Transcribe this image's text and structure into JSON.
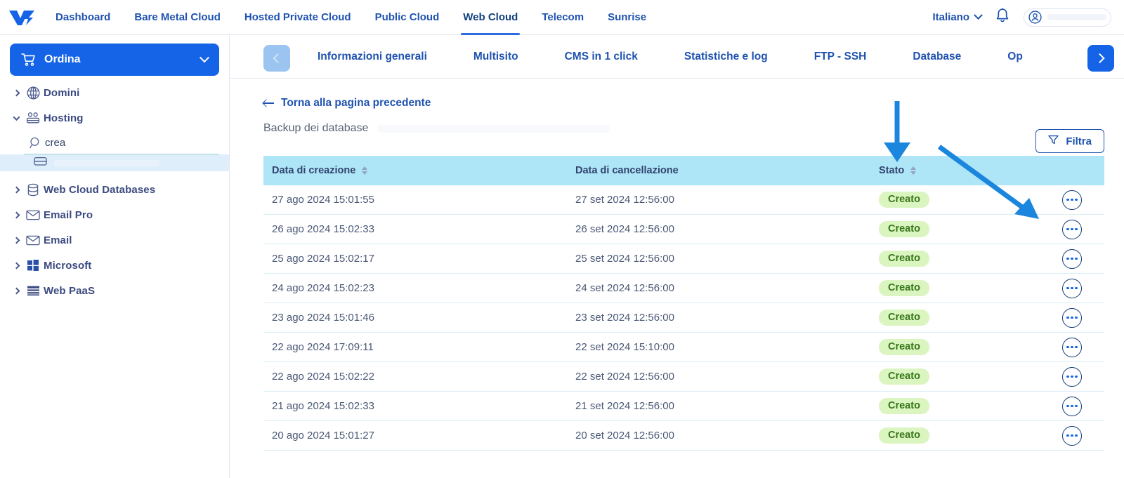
{
  "header": {
    "logo_name": "ovh-logo",
    "nav": [
      {
        "label": "Dashboard",
        "active": false
      },
      {
        "label": "Bare Metal Cloud",
        "active": false
      },
      {
        "label": "Hosted Private Cloud",
        "active": false
      },
      {
        "label": "Public Cloud",
        "active": false
      },
      {
        "label": "Web Cloud",
        "active": true
      },
      {
        "label": "Telecom",
        "active": false
      },
      {
        "label": "Sunrise",
        "active": false
      }
    ],
    "language": "Italiano",
    "bell_icon": "notification-bell-icon",
    "account_icon": "user-account-icon"
  },
  "sidebar": {
    "order_button": "Ordina",
    "order_icon": "shopping-cart-icon",
    "items": [
      {
        "label": "Domini",
        "icon": "globe-icon",
        "expanded": false
      },
      {
        "label": "Hosting",
        "icon": "hosting-icon",
        "expanded": true
      },
      {
        "label": "Web Cloud Databases",
        "icon": "database-icon",
        "expanded": false
      },
      {
        "label": "Email Pro",
        "icon": "envelope-icon",
        "expanded": false
      },
      {
        "label": "Email",
        "icon": "envelope-icon",
        "expanded": false
      },
      {
        "label": "Microsoft",
        "icon": "windows-icon",
        "expanded": false
      },
      {
        "label": "Web PaaS",
        "icon": "layers-icon",
        "expanded": false
      }
    ],
    "search": {
      "value": "crea",
      "placeholder": "",
      "icon": "search-icon"
    },
    "selected_subitem": {
      "icon": "server-icon",
      "label": ""
    }
  },
  "tabbar": {
    "prev_icon": "chevron-left-icon",
    "next_icon": "chevron-right-icon",
    "tabs": [
      {
        "label": "Informazioni generali"
      },
      {
        "label": "Multisito"
      },
      {
        "label": "CMS in 1 click"
      },
      {
        "label": "Statistiche e log"
      },
      {
        "label": "FTP - SSH"
      },
      {
        "label": "Database"
      },
      {
        "label": "Op"
      }
    ]
  },
  "content": {
    "back_link": "Torna alla pagina precedente",
    "back_icon": "arrow-left-icon",
    "page_title": "Backup dei database",
    "filter_button": "Filtra",
    "filter_icon": "funnel-icon"
  },
  "table": {
    "columns": [
      {
        "label": "Data di creazione",
        "sortable": true
      },
      {
        "label": "Data di cancellazione",
        "sortable": false
      },
      {
        "label": "Stato",
        "sortable": true
      },
      {
        "label": "",
        "sortable": false
      }
    ],
    "rows": [
      {
        "created": "27 ago 2024 15:01:55",
        "deleted": "27 set 2024 12:56:00",
        "status": "Creato"
      },
      {
        "created": "26 ago 2024 15:02:33",
        "deleted": "26 set 2024 12:56:00",
        "status": "Creato"
      },
      {
        "created": "25 ago 2024 15:02:17",
        "deleted": "25 set 2024 12:56:00",
        "status": "Creato"
      },
      {
        "created": "24 ago 2024 15:02:23",
        "deleted": "24 set 2024 12:56:00",
        "status": "Creato"
      },
      {
        "created": "23 ago 2024 15:01:46",
        "deleted": "23 set 2024 12:56:00",
        "status": "Creato"
      },
      {
        "created": "22 ago 2024 17:09:11",
        "deleted": "22 set 2024 15:10:00",
        "status": "Creato"
      },
      {
        "created": "22 ago 2024 15:02:22",
        "deleted": "22 set 2024 12:56:00",
        "status": "Creato"
      },
      {
        "created": "21 ago 2024 15:02:33",
        "deleted": "21 set 2024 12:56:00",
        "status": "Creato"
      },
      {
        "created": "20 ago 2024 15:01:27",
        "deleted": "20 set 2024 12:56:00",
        "status": "Creato"
      }
    ],
    "row_action_icon": "more-actions-icon"
  },
  "annotations": {
    "color": "#1b86dd",
    "arrows": [
      {
        "name": "down-arrow-annotation"
      },
      {
        "name": "diagonal-arrow-annotation"
      }
    ]
  },
  "colors": {
    "brand_blue": "#1564e8",
    "nav_blue": "#1f53b0",
    "table_header": "#aee5f7",
    "badge_bg": "#dbf5c0",
    "badge_text": "#37761a"
  }
}
